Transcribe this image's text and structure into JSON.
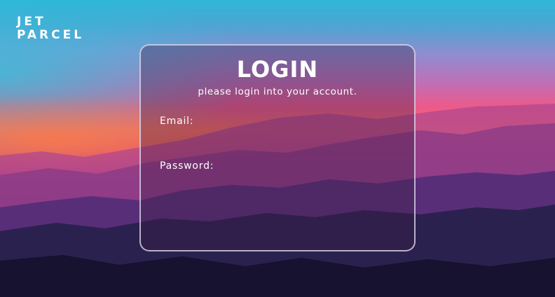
{
  "brand": {
    "line1": "JET",
    "line2": "PARCEL"
  },
  "login": {
    "title": "LOGIN",
    "subtitle": "please login into your account.",
    "email_label": "Email:",
    "email_value": "",
    "password_label": "Password:",
    "password_value": ""
  }
}
